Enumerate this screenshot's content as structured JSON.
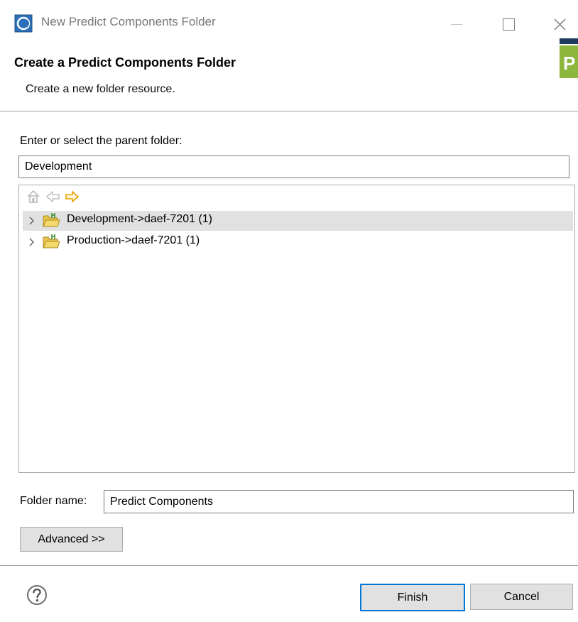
{
  "window": {
    "title": "New Predict Components Folder",
    "icon": "eclipse-app-icon",
    "controls": [
      "minimize-icon",
      "maximize-icon",
      "close-icon"
    ]
  },
  "header": {
    "title": "Create a Predict Components Folder",
    "description": "Create a new folder resource.",
    "banner_letter": "P",
    "banner_color": "#8cb63c"
  },
  "parent": {
    "label": "Enter or select the parent folder:",
    "value": "Development"
  },
  "tree": {
    "toolbar": [
      "home-icon",
      "back-arrow-icon",
      "forward-arrow-icon"
    ],
    "items": [
      {
        "label": "Development->daef-7201 (1)",
        "selected": true,
        "icon": "project-folder-icon"
      },
      {
        "label": "Production->daef-7201 (1)",
        "selected": false,
        "icon": "project-folder-icon"
      }
    ]
  },
  "folder_name": {
    "label": "Folder name:",
    "value": "Predict Components"
  },
  "buttons": {
    "advanced": "Advanced >>",
    "finish": "Finish",
    "cancel": "Cancel",
    "help_icon": "help-icon"
  },
  "colors": {
    "accent": "#0078d7",
    "selection": "#e1e1e1",
    "arrow_forward": "#e8a200"
  }
}
